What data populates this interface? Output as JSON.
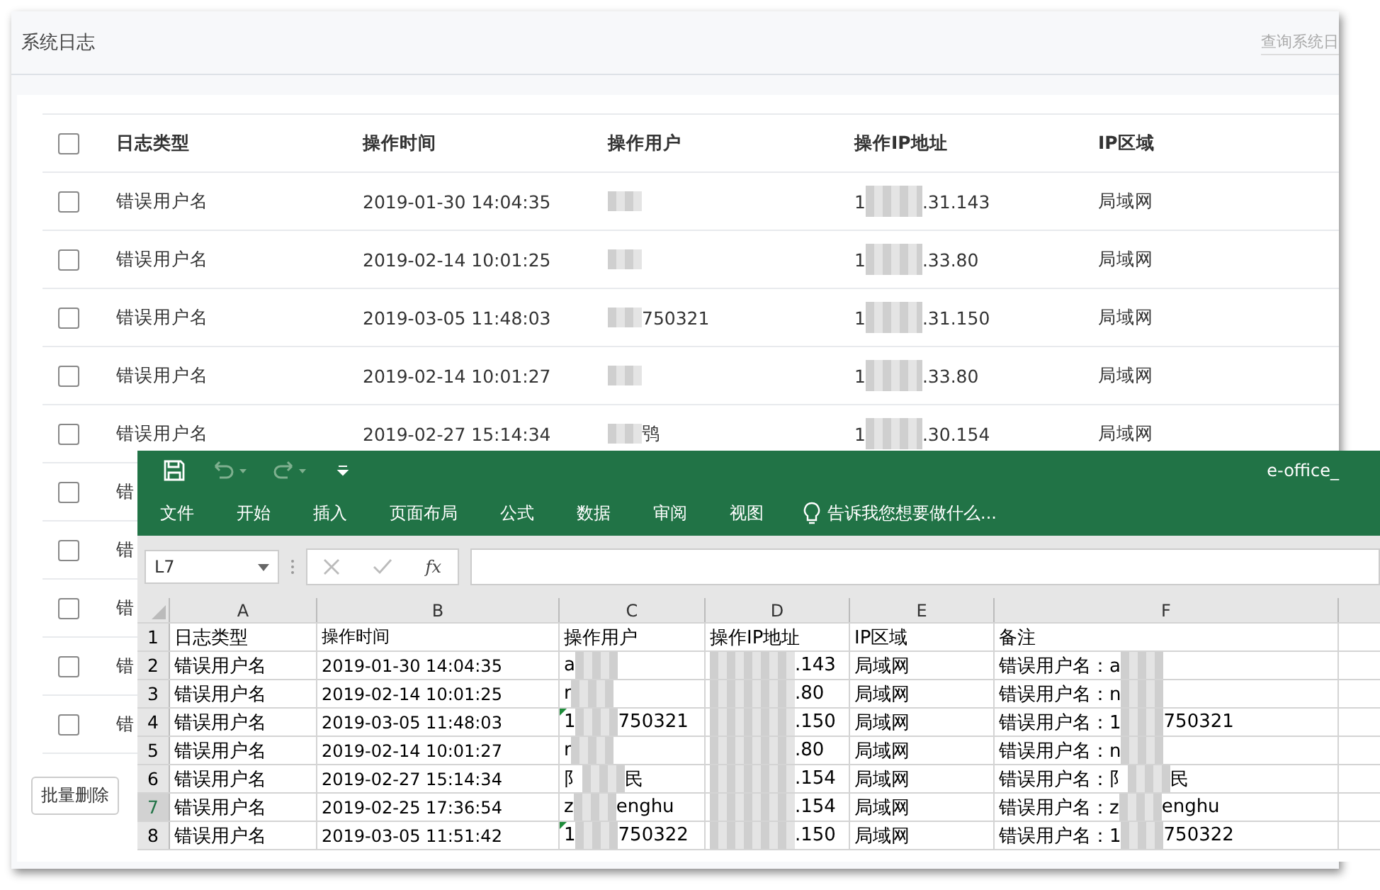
{
  "page": {
    "title": "系统日志",
    "search": {
      "placeholder": "查询系统日"
    }
  },
  "table": {
    "columns": [
      "日志类型",
      "操作时间",
      "操作用户",
      "操作IP地址",
      "IP区域"
    ],
    "header_checked": false,
    "rows": [
      {
        "checked": false,
        "type": "错误用户名",
        "time": "2019-01-30 14:04:35",
        "user": {},
        "ip": {
          "before": "1",
          "after": ".31.143"
        },
        "region": "局域网"
      },
      {
        "checked": false,
        "type": "错误用户名",
        "time": "2019-02-14 10:01:25",
        "user": {},
        "ip": {
          "before": "1",
          "after": ".33.80"
        },
        "region": "局域网"
      },
      {
        "checked": false,
        "type": "错误用户名",
        "time": "2019-03-05 11:48:03",
        "user": {
          "after": "750321"
        },
        "ip": {
          "before": "1",
          "after": ".31.150"
        },
        "region": "局域网"
      },
      {
        "checked": false,
        "type": "错误用户名",
        "time": "2019-02-14 10:01:27",
        "user": {},
        "ip": {
          "before": "1",
          "after": ".33.80"
        },
        "region": "局域网"
      },
      {
        "checked": false,
        "type": "错误用户名",
        "time": "2019-02-27 15:14:34",
        "user": {
          "after": "鸮"
        },
        "ip": {
          "before": "1",
          "after": ".30.154"
        },
        "region": "局域网"
      },
      {
        "checked": false,
        "type": "错"
      },
      {
        "checked": false,
        "type": "错"
      },
      {
        "checked": false,
        "type": "错"
      },
      {
        "checked": false,
        "type": "错"
      },
      {
        "checked": false,
        "type": "错"
      }
    ],
    "bulk_delete_button": "批量删除"
  },
  "excel": {
    "title": "e-office_",
    "ribbon_tabs": [
      "文件",
      "开始",
      "插入",
      "页面布局",
      "公式",
      "数据",
      "审阅",
      "视图"
    ],
    "tell_me": "告诉我您想要做什么...",
    "name_box": "L7",
    "fx": "fx",
    "column_headers": [
      "A",
      "B",
      "C",
      "D",
      "E",
      "F"
    ],
    "rows": [
      {
        "number": "1",
        "selected": false,
        "cells": [
          {
            "after": "日志类型"
          },
          {
            "after": "操作时间"
          },
          {
            "after": "操作用户"
          },
          {
            "after": "操作IP地址"
          },
          {
            "after": "IP区域"
          },
          {
            "after": "备注"
          }
        ]
      },
      {
        "number": "2",
        "selected": false,
        "cells": [
          {
            "after": "错误用户名"
          },
          {
            "after": "2019-01-30 14:04:35"
          },
          {
            "before": "a"
          },
          {
            "after": ".143"
          },
          {
            "after": "局域网"
          },
          {
            "before": "错误用户名：a"
          }
        ]
      },
      {
        "number": "3",
        "selected": false,
        "cells": [
          {
            "after": "错误用户名"
          },
          {
            "after": "2019-02-14 10:01:25"
          },
          {
            "before": "r"
          },
          {
            "after": ".80"
          },
          {
            "after": "局域网"
          },
          {
            "before": "错误用户名：n"
          }
        ]
      },
      {
        "number": "4",
        "selected": false,
        "cells": [
          {
            "after": "错误用户名"
          },
          {
            "after": "2019-03-05 11:48:03"
          },
          {
            "before": "1",
            "after": "750321",
            "flag": true
          },
          {
            "after": ".150"
          },
          {
            "after": "局域网"
          },
          {
            "before": "错误用户名：1",
            "after": "750321"
          }
        ]
      },
      {
        "number": "5",
        "selected": false,
        "cells": [
          {
            "after": "错误用户名"
          },
          {
            "after": "2019-02-14 10:01:27"
          },
          {
            "before": "r"
          },
          {
            "after": ".80"
          },
          {
            "after": "局域网"
          },
          {
            "before": "错误用户名：n"
          }
        ]
      },
      {
        "number": "6",
        "selected": false,
        "cells": [
          {
            "after": "错误用户名"
          },
          {
            "after": "2019-02-27 15:14:34"
          },
          {
            "before": "阝",
            "after": "民"
          },
          {
            "after": ".154"
          },
          {
            "after": "局域网"
          },
          {
            "before": "错误用户名：阝",
            "after": "民"
          }
        ]
      },
      {
        "number": "7",
        "selected": true,
        "cells": [
          {
            "after": "错误用户名"
          },
          {
            "after": "2019-02-25 17:36:54"
          },
          {
            "before": "z",
            "after": "enghu"
          },
          {
            "after": ".154"
          },
          {
            "after": "局域网"
          },
          {
            "before": "错误用户名：z",
            "after": "enghu"
          }
        ]
      },
      {
        "number": "8",
        "selected": false,
        "cells": [
          {
            "after": "错误用户名"
          },
          {
            "after": "2019-03-05 11:51:42"
          },
          {
            "before": "1",
            "after": "750322",
            "flag": true
          },
          {
            "after": ".150"
          },
          {
            "after": "局域网"
          },
          {
            "before": "错误用户名：1",
            "after": "750322"
          }
        ]
      }
    ]
  }
}
